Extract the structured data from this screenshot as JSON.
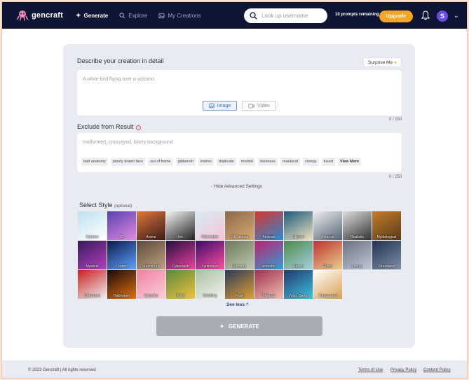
{
  "nav": {
    "logo_text": "gencraft",
    "links": [
      {
        "label": "Generate",
        "icon": "sparkle-icon"
      },
      {
        "label": "Explore",
        "icon": "search-icon"
      },
      {
        "label": "My Creations",
        "icon": "gallery-icon"
      }
    ],
    "search_placeholder": "Look up username",
    "prompts_remaining": "10 prompts remaining",
    "upgrade_label": "Upgrade",
    "avatar_letter": "S",
    "accent": "#f4a623",
    "bg": "#0e1535"
  },
  "describe": {
    "label": "Describe your creation in detail",
    "surprise_label": "Surprise Me",
    "placeholder": "A white bird flying over a volcano",
    "image_label": "Image",
    "video_label": "Video",
    "count": "0 / 250"
  },
  "exclude": {
    "label": "Exclude from Result",
    "placeholder": "malformed, crosseyed, blurry background",
    "chips": [
      "bad anatomy",
      "poorly drawn face",
      "out of frame",
      "gibberish",
      "lowres",
      "duplicate",
      "morbid",
      "darkness",
      "maniacal",
      "creepy",
      "fused"
    ],
    "view_more": "View More",
    "count": "0 / 250"
  },
  "advanced_label": "- Hide Advanced Settings",
  "style": {
    "title": "Select Style",
    "optional": "(optional)",
    "tiles": [
      {
        "label": "Cartoon",
        "c1": "#bfe0ef",
        "c2": "#ffffff"
      },
      {
        "label": "3D",
        "c1": "#5a3fb0",
        "c2": "#e08be0"
      },
      {
        "label": "Anime",
        "c1": "#e0783a",
        "c2": "#3a1a1a"
      },
      {
        "label": "Ink",
        "c1": "#f4f4f4",
        "c2": "#222222"
      },
      {
        "label": "Watercolor",
        "c1": "#d6ecf5",
        "c2": "#f7c3d8"
      },
      {
        "label": "Oil Painting",
        "c1": "#8a6a4a",
        "c2": "#d8a870"
      },
      {
        "label": "Abstract",
        "c1": "#d9352b",
        "c2": "#2a8ad1"
      },
      {
        "label": "Ukiyo-e",
        "c1": "#1a5a7a",
        "c2": "#f0e2c0"
      },
      {
        "label": "Polaroid",
        "c1": "#eeeeee",
        "c2": "#556677"
      },
      {
        "label": "Realistic",
        "c1": "#dddddd",
        "c2": "#333333"
      },
      {
        "label": "Mythological",
        "c1": "#c27d2c",
        "c2": "#5a3a18"
      },
      {
        "label": "Mystical",
        "c1": "#3a1a5a",
        "c2": "#b040c0"
      },
      {
        "label": "Cosmic",
        "c1": "#0a1a4a",
        "c2": "#60a0ff"
      },
      {
        "label": "Steampunk",
        "c1": "#5a4a3a",
        "c2": "#c0a080"
      },
      {
        "label": "Cyberpunk",
        "c1": "#201040",
        "c2": "#f040a0"
      },
      {
        "label": "Synthwave",
        "c1": "#3a0a6a",
        "c2": "#ff4fa0"
      },
      {
        "label": "Diorama",
        "c1": "#6a7a5a",
        "c2": "#c0c8b0"
      },
      {
        "label": "Isometric",
        "c1": "#c02070",
        "c2": "#30a0d0"
      },
      {
        "label": "Nature",
        "c1": "#4a8a4a",
        "c2": "#a8d0e0"
      },
      {
        "label": "Floral",
        "c1": "#c03030",
        "c2": "#e8d090"
      },
      {
        "label": "Luxury",
        "c1": "#6a7080",
        "c2": "#c0c8d8"
      },
      {
        "label": "Streetwear",
        "c1": "#203050",
        "c2": "#8090a8"
      },
      {
        "label": "Christmas",
        "c1": "#c82020",
        "c2": "#f0f0f0"
      },
      {
        "label": "Halloween",
        "c1": "#1a0a0a",
        "c2": "#e07010"
      },
      {
        "label": "Valentine",
        "c1": "#f080a0",
        "c2": "#fbd0dc"
      },
      {
        "label": "Party",
        "c1": "#5a8a3a",
        "c2": "#f0c040"
      },
      {
        "label": "Wedding",
        "c1": "#a8c0a0",
        "c2": "#f4f4f0"
      },
      {
        "label": "Food",
        "c1": "#2a3a5a",
        "c2": "#e0a030"
      },
      {
        "label": "Makeup",
        "c1": "#a03050",
        "c2": "#f0c0b0"
      },
      {
        "label": "Video Game",
        "c1": "#203a6a",
        "c2": "#40c0e0"
      },
      {
        "label": "Transparent",
        "c1": "#ffffff",
        "c2": "#d8a050"
      }
    ],
    "see_less": "See less ^"
  },
  "generate_label": "GENERATE",
  "footer": {
    "copyright": "© 2023 Gencraft | All rights reserved",
    "links": [
      "Terms of Use",
      "Privacy Policy",
      "Content Policy"
    ]
  }
}
